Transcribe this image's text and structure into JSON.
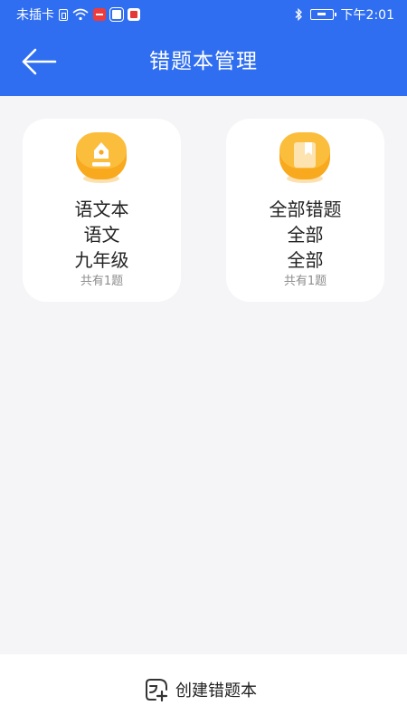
{
  "status_bar": {
    "carrier": "未插卡",
    "time": "下午2:01"
  },
  "header": {
    "title": "错题本管理",
    "back_icon": "back-arrow-icon"
  },
  "notebooks": [
    {
      "icon": "pen-nib-icon",
      "name": "语文本",
      "subject": "语文",
      "grade": "九年级",
      "count": "共有1题"
    },
    {
      "icon": "book-icon",
      "name": "全部错题",
      "subject": "全部",
      "grade": "全部",
      "count": "共有1题"
    }
  ],
  "footer": {
    "create_label": "创建错题本",
    "create_icon": "add-note-icon"
  },
  "colors": {
    "header_blue": "#2f6ef0",
    "icon_orange": "#f7a51c",
    "background": "#f5f4f7"
  }
}
